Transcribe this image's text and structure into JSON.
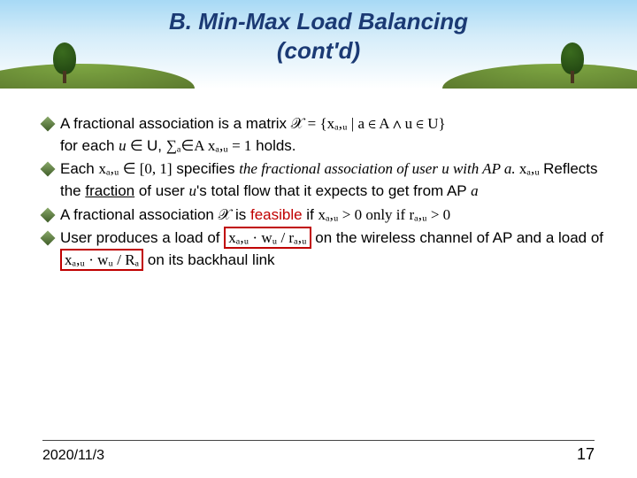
{
  "title_line1": "B. Min-Max Load Balancing",
  "title_line2": "(cont'd)",
  "bullets": {
    "b1a": "A fractional association is a matrix ",
    "b1_math1": "𝒳 = {xₐ,ᵤ | a ∈ A ∧ u ∈ U}",
    "b1b": "for each ",
    "b1_u": "u",
    "b1_in": " ∈ ",
    "b1_Ucomma": "U, ",
    "b1_math2": "∑ₐ∈A xₐ,ᵤ = 1",
    "b1c": " holds.",
    "b2a": "Each ",
    "b2_math1": "xₐ,ᵤ ∈ [0, 1]",
    "b2b": " specifies ",
    "b2_it1": "the fractional association of user u with AP a.",
    "b2_math2": " xₐ,ᵤ ",
    "b2c": "Reflects the ",
    "b2_frac": "fraction",
    "b2d": " of user ",
    "b2_u": "u",
    "b2e": "'s total flow that it expects to get from AP ",
    "b2_a": "a",
    "b3a": "A fractional association ",
    "b3_math1": "𝒳",
    "b3b": " is ",
    "b3_feasible": "feasible",
    "b3c": " if ",
    "b3_math2": "xₐ,ᵤ > 0 only if rₐ,ᵤ > 0",
    "b4a": "User produces a load of  ",
    "b4_box1": "xₐ,ᵤ · wᵤ / rₐ,ᵤ",
    "b4b": " on the wireless channel of AP and a load of ",
    "b4_box2": "xₐ,ᵤ · wᵤ / Rₐ",
    "b4c": " on its backhaul link"
  },
  "footer": {
    "date": "2020/11/3",
    "page": "17"
  }
}
